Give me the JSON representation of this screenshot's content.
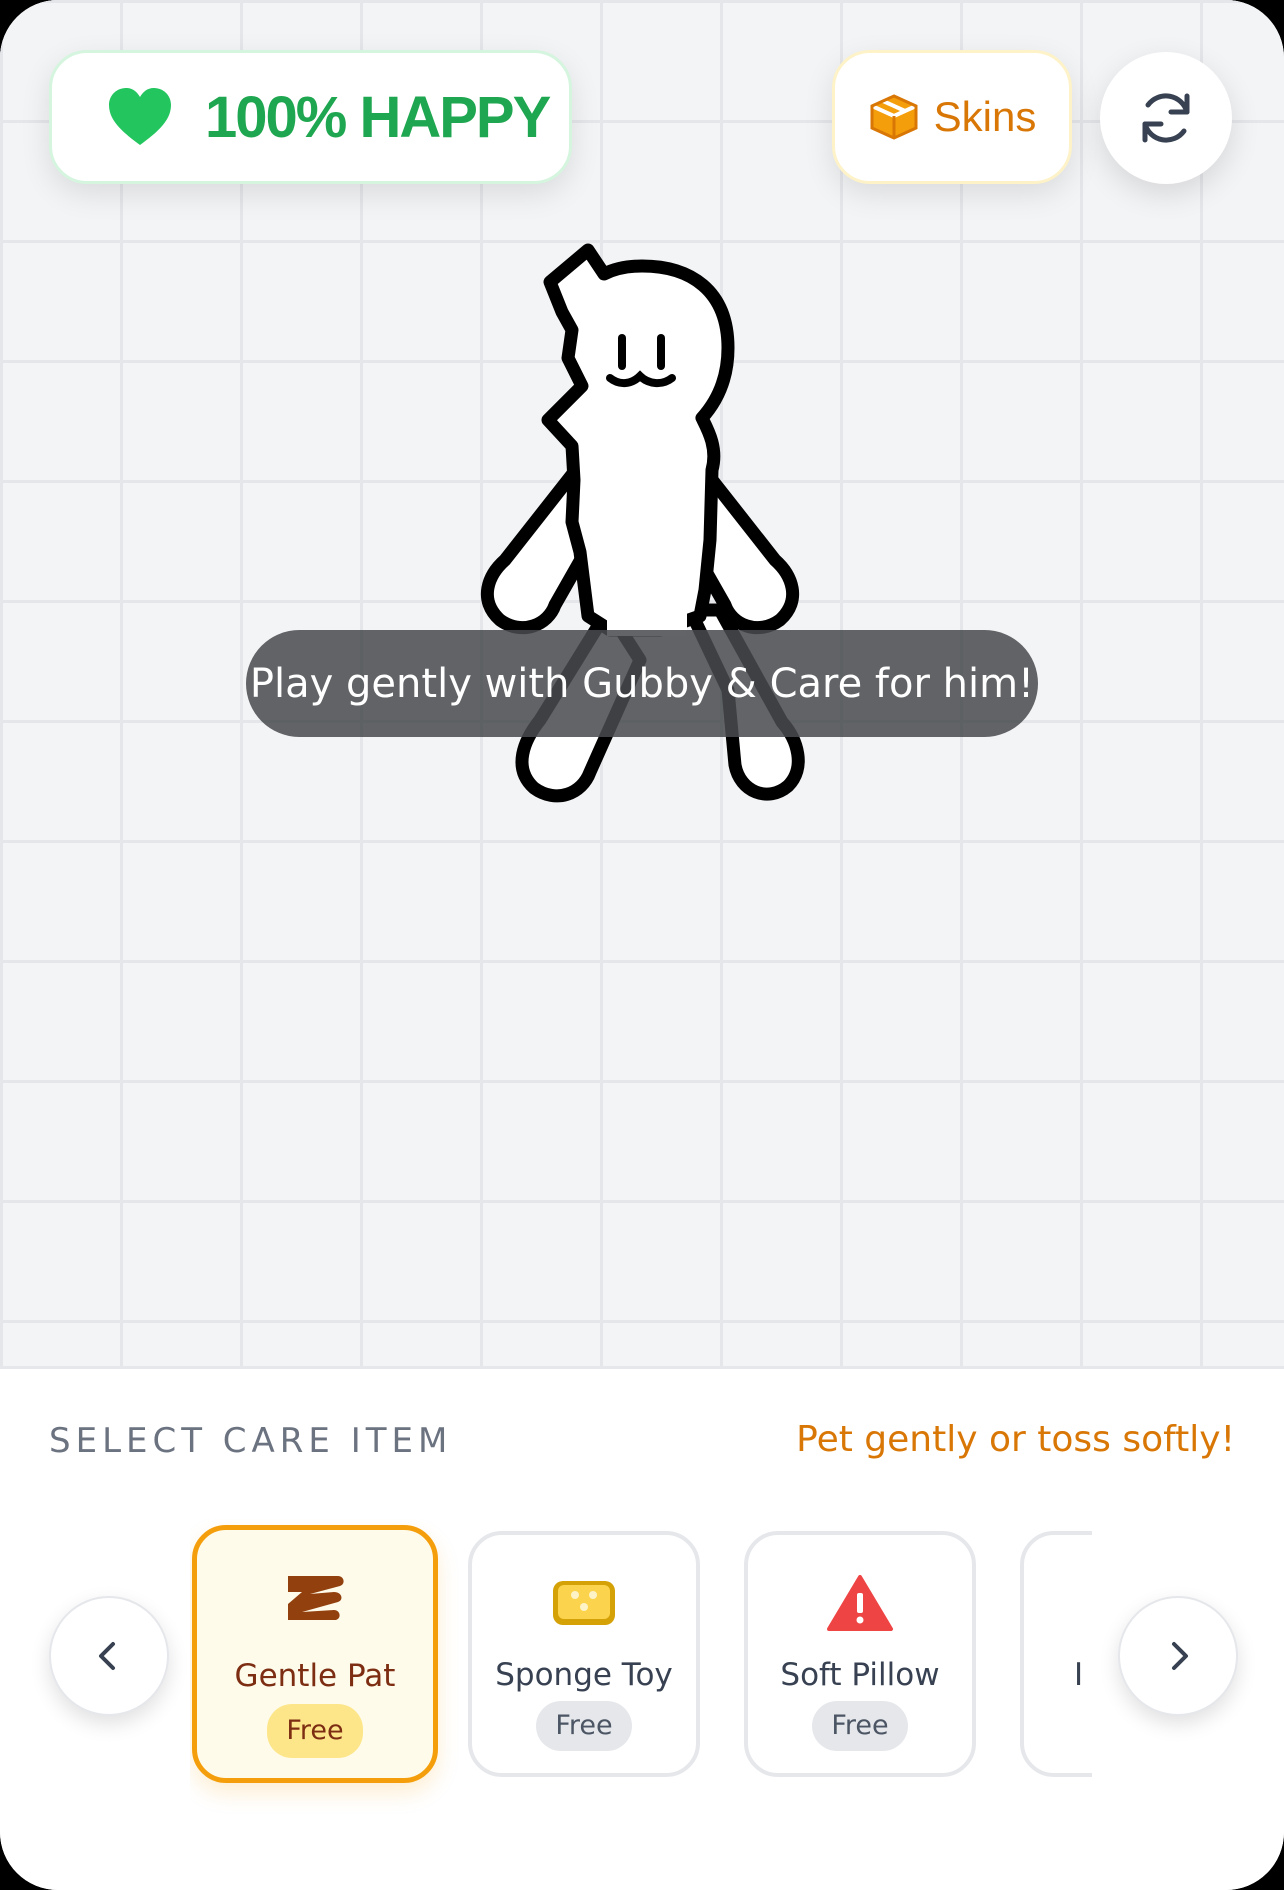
{
  "status": {
    "happiness_label": "100% HAPPY",
    "happiness_percent": 100,
    "accent": "#1fa650"
  },
  "header": {
    "skins_label": "Skins",
    "skins_icon": "box-icon",
    "refresh_icon": "refresh-icon"
  },
  "pet": {
    "name": "Gubby"
  },
  "toast": {
    "message": "Play gently with Gubby & Care for him!"
  },
  "care_panel": {
    "title": "SELECT CARE ITEM",
    "hint": "Pet gently or toss softly!",
    "hint_color": "#d97706",
    "items": [
      {
        "label": "Gentle Pat",
        "price": "Free",
        "icon": "hand-icon",
        "selected": true
      },
      {
        "label": "Sponge Toy",
        "price": "Free",
        "icon": "sponge-icon",
        "selected": false
      },
      {
        "label": "Soft Pillow",
        "price": "Free",
        "icon": "warning-icon",
        "selected": false
      },
      {
        "label": "I",
        "price": "",
        "icon": "",
        "selected": false
      }
    ]
  }
}
